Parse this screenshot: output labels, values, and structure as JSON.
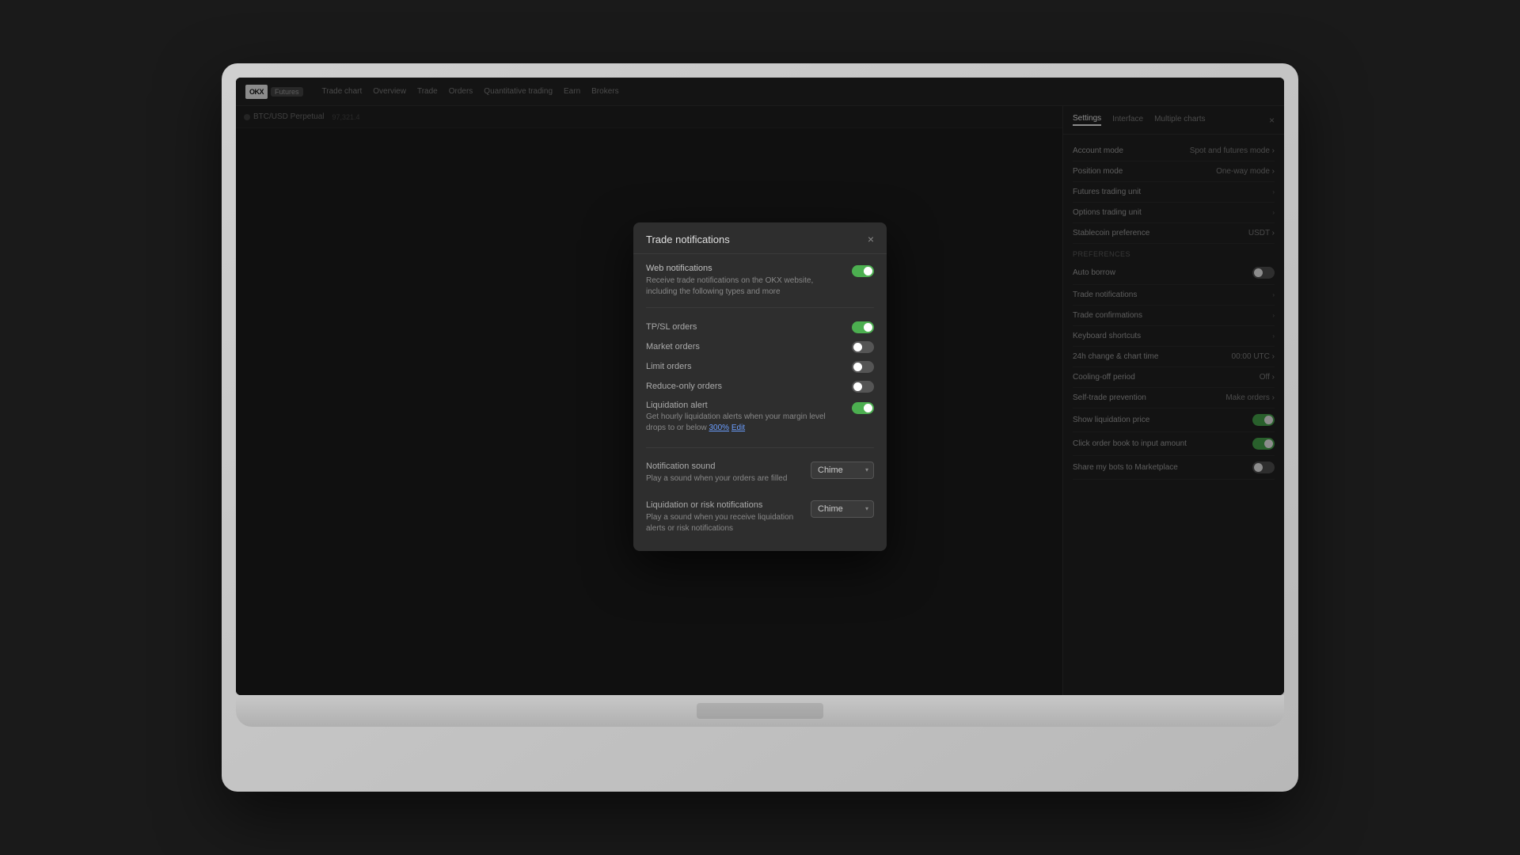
{
  "laptop": {
    "screen_bg": "#1e1e1e"
  },
  "app": {
    "logo": "OKX",
    "nav_badge": "Futures",
    "nav_items": [
      "Trade chart",
      "Overview",
      "Trade",
      "Orders",
      "Quantitative trading",
      "Earn",
      "Brokers"
    ],
    "instrument": "BTC/USD Perpetual"
  },
  "settings_panel": {
    "tabs": [
      "Settings",
      "Interface",
      "Multiple charts"
    ],
    "close_label": "×",
    "account_mode": {
      "label": "Account mode",
      "value": "Spot and futures mode ›"
    },
    "position_mode": {
      "label": "Position mode",
      "value": "One-way mode ›"
    },
    "futures_trading_unit": {
      "label": "Futures trading unit",
      "value": "›"
    },
    "options_trading_unit": {
      "label": "Options trading unit",
      "value": "›"
    },
    "stablecoin_preference": {
      "label": "Stablecoin preference",
      "value": "USDT ›"
    },
    "preferences_header": "Preferences",
    "auto_borrow": {
      "label": "Auto borrow",
      "toggle": "off"
    },
    "trade_notifications": {
      "label": "Trade notifications",
      "value": "›"
    },
    "trade_confirmations": {
      "label": "Trade confirmations",
      "value": "›"
    },
    "keyboard_shortcuts": {
      "label": "Keyboard shortcuts",
      "value": "›"
    },
    "chart_time": {
      "label": "24h change & chart time",
      "value": "00:00 UTC ›"
    },
    "cooling_off": {
      "label": "Cooling-off period",
      "value": "Off ›"
    },
    "self_trade": {
      "label": "Self-trade prevention",
      "value": "Make orders ›"
    },
    "show_liquidation_price": {
      "label": "Show liquidation price",
      "toggle": "on"
    },
    "click_order_book": {
      "label": "Click order book to input amount",
      "toggle": "on"
    },
    "share_bots": {
      "label": "Share my bots to Marketplace",
      "toggle": "off"
    }
  },
  "modal": {
    "title": "Trade notifications",
    "close": "×",
    "web_notifications": {
      "label": "Web notifications",
      "sub_label": "Receive trade notifications on the OKX website, including the following types and more",
      "toggle": "on"
    },
    "tp_sl_orders": {
      "label": "TP/SL orders",
      "toggle": "on"
    },
    "market_orders": {
      "label": "Market orders",
      "toggle": "off"
    },
    "limit_orders": {
      "label": "Limit orders",
      "toggle": "off"
    },
    "reduce_only_orders": {
      "label": "Reduce-only orders",
      "toggle": "off"
    },
    "liquidation_alert": {
      "label": "Liquidation alert",
      "sub_label": "Get hourly liquidation alerts when your margin level drops to or below",
      "highlight": "300%",
      "edit_label": "Edit",
      "toggle": "on"
    },
    "notification_sound": {
      "label": "Notification sound",
      "sub_label": "Play a sound when your orders are filled",
      "value": "Chime"
    },
    "liquidation_risk": {
      "label": "Liquidation or risk notifications",
      "sub_label": "Play a sound when you receive liquidation alerts or risk notifications",
      "value": "Chime"
    }
  }
}
